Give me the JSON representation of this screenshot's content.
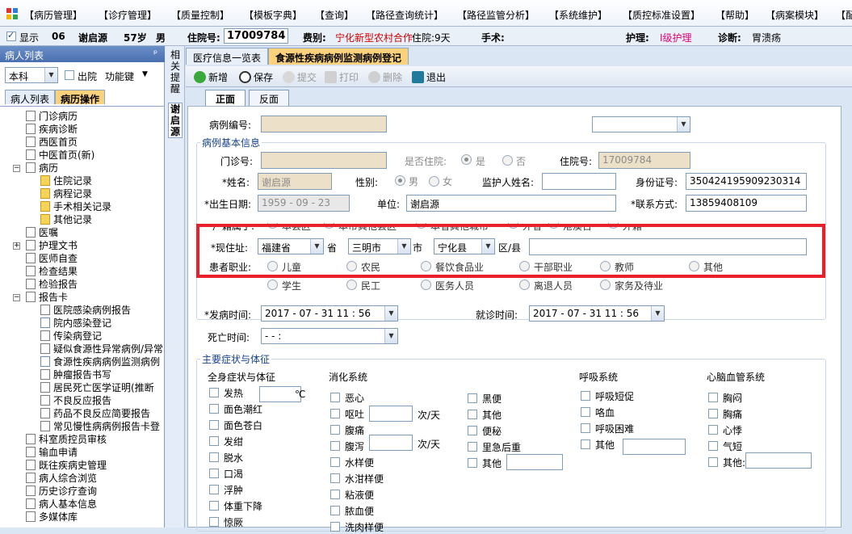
{
  "menu": [
    "【病历管理】",
    "【诊疗管理】",
    "【质量控制】",
    "【模板字典】",
    "【查询】",
    "【路径查询统计】",
    "【路径监管分析】",
    "【系统维护】",
    "【质控标准设置】",
    "【帮助】",
    "【病案模块】",
    "【配"
  ],
  "patient": {
    "show_label": "显示",
    "bed": "06",
    "name": "谢启源",
    "age": "57岁",
    "sex": "男",
    "inpatient_label": "住院号:",
    "inpatient_no": "17009784",
    "fee_label": "费别:",
    "fee": "宁化新型农村合作",
    "stay": "住院:9天",
    "surgery_label": "手术:",
    "nursing_label": "护理:",
    "nursing": "I级护理",
    "diagnosis_label": "诊断:",
    "diagnosis": "胃溃疡"
  },
  "left": {
    "title": "病人列表",
    "pin": "ᵖ",
    "dept": "本科",
    "discharge_label": "出院",
    "func_key": "功能键",
    "tabs": [
      "病人列表",
      "病历操作"
    ],
    "tree": [
      {
        "l": "门诊病历",
        "ind": 2,
        "t": "doc"
      },
      {
        "l": "疾病诊断",
        "ind": 2,
        "t": "doc"
      },
      {
        "l": "西医首页",
        "ind": 2,
        "t": "doc"
      },
      {
        "l": "中医首页(新)",
        "ind": 2,
        "t": "doc"
      },
      {
        "l": "病历",
        "ind": 2,
        "t": "doc",
        "pm": "−"
      },
      {
        "l": "住院记录",
        "ind": 3,
        "t": "folder"
      },
      {
        "l": "病程记录",
        "ind": 3,
        "t": "folder"
      },
      {
        "l": "手术相关记录",
        "ind": 3,
        "t": "folder"
      },
      {
        "l": "其他记录",
        "ind": 3,
        "t": "folder"
      },
      {
        "l": "医嘱",
        "ind": 2,
        "t": "doc"
      },
      {
        "l": "护理文书",
        "ind": 2,
        "t": "doc",
        "pm": "+"
      },
      {
        "l": "医师自查",
        "ind": 2,
        "t": "doc"
      },
      {
        "l": "检查结果",
        "ind": 2,
        "t": "doc"
      },
      {
        "l": "检验报告",
        "ind": 2,
        "t": "doc"
      },
      {
        "l": "报告卡",
        "ind": 2,
        "t": "doc",
        "pm": "−"
      },
      {
        "l": "医院感染病例报告",
        "ind": 3,
        "t": "doc"
      },
      {
        "l": "院内感染登记",
        "ind": 3,
        "t": "chk"
      },
      {
        "l": "传染病登记",
        "ind": 3,
        "t": "doc"
      },
      {
        "l": "疑似食源性异常病例/异常",
        "ind": 3,
        "t": "doc"
      },
      {
        "l": "食源性疾病病例监测病例",
        "ind": 3,
        "t": "chk"
      },
      {
        "l": "肿瘤报告书写",
        "ind": 3,
        "t": "doc"
      },
      {
        "l": "居民死亡医学证明(推断",
        "ind": 3,
        "t": "doc"
      },
      {
        "l": "不良反应报告",
        "ind": 3,
        "t": "doc"
      },
      {
        "l": "药品不良反应简要报告",
        "ind": 3,
        "t": "doc"
      },
      {
        "l": "常见慢性病病例报告卡登",
        "ind": 3,
        "t": "doc"
      },
      {
        "l": "科室质控员审核",
        "ind": 2,
        "t": "doc"
      },
      {
        "l": "输血申请",
        "ind": 2,
        "t": "doc"
      },
      {
        "l": "既往疾病史管理",
        "ind": 2,
        "t": "doc"
      },
      {
        "l": "病人综合浏览",
        "ind": 2,
        "t": "doc"
      },
      {
        "l": "历史诊疗查询",
        "ind": 2,
        "t": "doc"
      },
      {
        "l": "病人基本信息",
        "ind": 2,
        "t": "doc"
      },
      {
        "l": "多媒体库",
        "ind": 2,
        "t": "doc"
      }
    ]
  },
  "vtabs": [
    "相关提醒",
    "谢启源"
  ],
  "doc_tabs": [
    "医疗信息一览表",
    "食源性疾病病例监测病例登记"
  ],
  "toolbar": [
    "新增",
    "保存",
    "提交",
    "打印",
    "删除",
    "退出"
  ],
  "sub_tabs": [
    "正面",
    "反面"
  ],
  "form": {
    "case_no_label": "病例编号:",
    "basic_title": "病例基本信息",
    "outpatient_label": "门诊号:",
    "inpatient_q": "是否住院:",
    "yes": "是",
    "no": "否",
    "inp_no_label": "住院号:",
    "inp_no": "17009784",
    "name_label": "*姓名:",
    "name": "谢启源",
    "sex_label": "性别:",
    "male": "男",
    "female": "女",
    "guardian_label": "监护人姓名:",
    "id_label": "身份证号:",
    "id": "350424195909230314",
    "birth_label": "*出生日期:",
    "birth": "1959 - 09 - 23",
    "unit_label": "单位:",
    "unit": "谢启源",
    "contact_label": "*联系方式:",
    "contact": "13859408109",
    "domicile_label": "*户籍属于:",
    "domicile_opts": [
      "本县区",
      "本市其他县区",
      "本省其他城市",
      "外省",
      "港澳台",
      "外籍"
    ],
    "address_label": "*现住址:",
    "province": "福建省",
    "prov_suffix": "省",
    "city": "三明市",
    "city_suffix": "市",
    "county": "宁化县",
    "county_suffix": "区/县",
    "job_label": "患者职业:",
    "jobs_row1": [
      "儿童",
      "农民",
      "餐饮食品业",
      "干部职业",
      "教师",
      "其他"
    ],
    "jobs_row2": [
      "学生",
      "民工",
      "医务人员",
      "离退人员",
      "家务及待业"
    ],
    "onset_label": "*发病时间:",
    "onset": "2017 - 07 - 31    11 : 56",
    "visit_label": "就诊时间:",
    "visit": "2017 - 07 - 31    11 : 56",
    "death_label": "死亡时间:",
    "death": "  -   -          :",
    "symptom_title": "主要症状与体征",
    "cols": {
      "c1": "全身症状与体征",
      "c2": "消化系统",
      "c4": "呼吸系统",
      "c5": "心脑血管系统"
    },
    "c1_items": [
      "发热",
      "面色潮红",
      "面色苍白",
      "发绀",
      "脱水",
      "口渴",
      "浮肿",
      "体重下降",
      "惊厥"
    ],
    "fever_unit": "℃",
    "c2_items": [
      "恶心",
      "呕吐",
      "腹痛",
      "腹泻",
      "水样便",
      "水泔样便",
      "粘液便",
      "脓血便",
      "洗肉样便"
    ],
    "times_unit": "次/天",
    "c3_items": [
      "黑便",
      "其他",
      "便秘",
      "里急后重",
      "其他"
    ],
    "c4_items": [
      "呼吸短促",
      "咯血",
      "呼吸困难",
      "其他"
    ],
    "c5_items": [
      "胸闷",
      "胸痛",
      "心悸",
      "气短",
      "其他:"
    ]
  }
}
